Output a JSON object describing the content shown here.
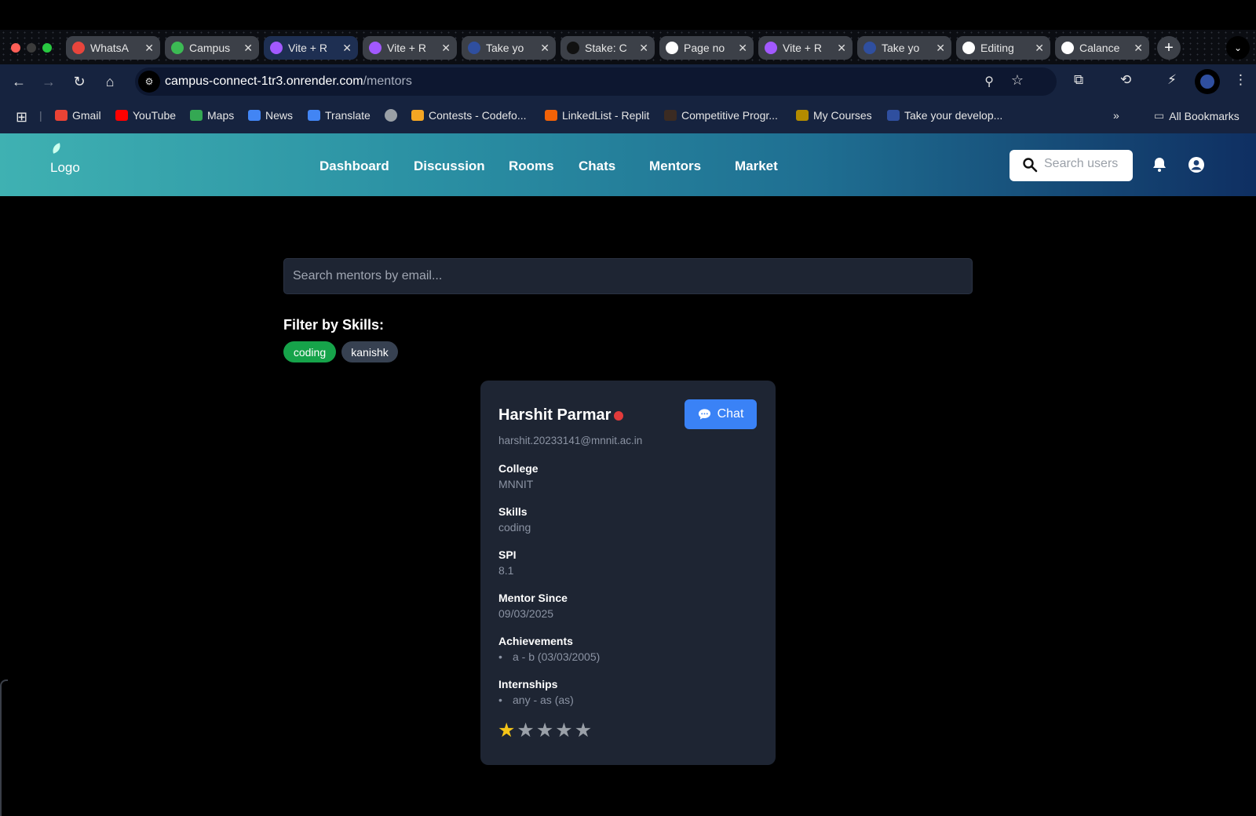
{
  "browser": {
    "tabs": [
      {
        "title": "WhatsA",
        "favicon": "whatsapp-icon",
        "color": "#e8453c",
        "active": false
      },
      {
        "title": "Campus",
        "favicon": "campus-icon",
        "color": "#3cba54",
        "active": false
      },
      {
        "title": "Vite + R",
        "favicon": "vite-icon",
        "color": "#a259ff",
        "active": true
      },
      {
        "title": "Vite + R",
        "favicon": "vite-icon",
        "color": "#a259ff",
        "active": false
      },
      {
        "title": "Take yo",
        "favicon": "avatar-icon",
        "color": "#2f4f9f",
        "active": false
      },
      {
        "title": "Stake: C",
        "favicon": "stake-icon",
        "color": "#111111",
        "active": false
      },
      {
        "title": "Page no",
        "favicon": "notion-icon",
        "color": "#ffffff",
        "active": false
      },
      {
        "title": "Vite + R",
        "favicon": "vite-icon",
        "color": "#a259ff",
        "active": false
      },
      {
        "title": "Take yo",
        "favicon": "avatar-icon",
        "color": "#2f4f9f",
        "active": false
      },
      {
        "title": "Editing",
        "favicon": "github-icon",
        "color": "#ffffff",
        "active": false
      },
      {
        "title": "Calance",
        "favicon": "openai-icon",
        "color": "#ffffff",
        "active": false
      }
    ],
    "url_domain": "campus-connect-1tr3.onrender.com",
    "url_path": "/mentors",
    "bookmarks": [
      {
        "label": "Gmail",
        "color": "#ea4335"
      },
      {
        "label": "YouTube",
        "color": "#ff0000"
      },
      {
        "label": "Maps",
        "color": "#34a853"
      },
      {
        "label": "News",
        "color": "#4285f4"
      },
      {
        "label": "Translate",
        "color": "#4285f4"
      },
      {
        "label": "",
        "color": "#9aa0a6"
      },
      {
        "label": "Contests - Codefo...",
        "color": "#f5a623"
      },
      {
        "label": "LinkedList - Replit",
        "color": "#f26207"
      },
      {
        "label": "Competitive Progr...",
        "color": "#3b2b22"
      },
      {
        "label": "My Courses",
        "color": "#b38b00"
      },
      {
        "label": "Take your develop...",
        "color": "#2f4f9f"
      }
    ],
    "all_bookmarks": "All Bookmarks"
  },
  "app": {
    "logo_text": "Logo",
    "nav": [
      "Dashboard",
      "Discussion",
      "Rooms",
      "Chats",
      "Mentors",
      "Market"
    ],
    "user_search_placeholder": "Search users",
    "mentor_search_placeholder": "Search mentors by email...",
    "filter_label": "Filter by Skills:",
    "skills": [
      {
        "label": "coding",
        "selected": true
      },
      {
        "label": "kanishk",
        "selected": false
      }
    ]
  },
  "mentor": {
    "name": "Harshit Parmar",
    "status_color": "#e23b3b",
    "chat_label": "Chat",
    "email": "harshit.20233141@mnnit.ac.in",
    "college_label": "College",
    "college": "MNNIT",
    "skills_label": "Skills",
    "skills": "coding",
    "spi_label": "SPI",
    "spi": "8.1",
    "mentor_since_label": "Mentor Since",
    "mentor_since": "09/03/2025",
    "achievements_label": "Achievements",
    "achievements": [
      "a - b (03/03/2005)"
    ],
    "internships_label": "Internships",
    "internships": [
      "any - as (as)"
    ],
    "rating": 1,
    "rating_max": 5
  },
  "colors": {
    "accent_green": "#16a34a",
    "chip_gray": "#374151",
    "chat_blue": "#3a82f6",
    "card_bg": "#1e2533"
  }
}
